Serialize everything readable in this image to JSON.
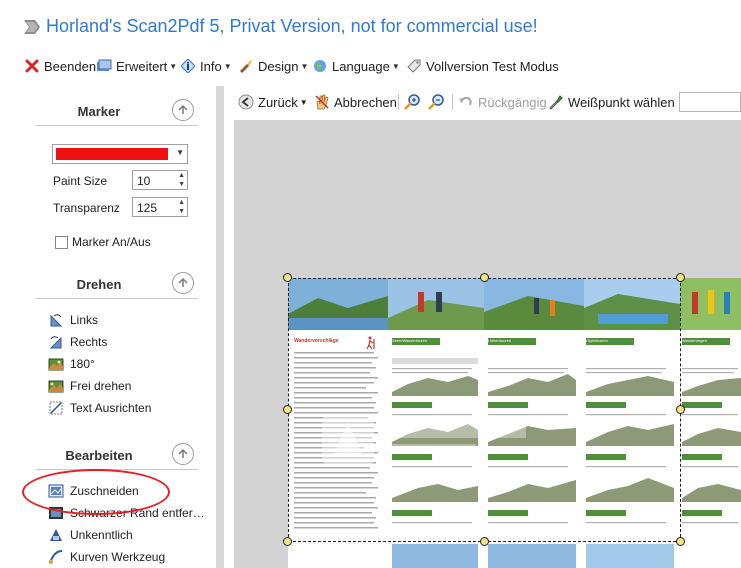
{
  "window": {
    "title": "Horland's Scan2Pdf 5, Privat Version, not for commercial use!"
  },
  "menu": {
    "items": [
      {
        "label": "Beenden",
        "icon": "close-x-icon",
        "dropdown": false
      },
      {
        "label": "Erweitert",
        "icon": "extended-icon",
        "dropdown": true
      },
      {
        "label": "Info",
        "icon": "info-icon",
        "dropdown": true
      },
      {
        "label": "Design",
        "icon": "design-icon",
        "dropdown": true
      },
      {
        "label": "Language",
        "icon": "language-icon",
        "dropdown": true
      },
      {
        "label": "Vollversion Test Modus",
        "icon": "tag-icon",
        "dropdown": false
      }
    ]
  },
  "sidebar": {
    "marker": {
      "title": "Marker",
      "color": "#ee1111",
      "paint_size_label": "Paint Size",
      "paint_size_value": "10",
      "transparenz_label": "Transparenz",
      "transparenz_value": "125",
      "marker_toggle_label": "Marker An/Aus",
      "marker_toggle_checked": false
    },
    "drehen": {
      "title": "Drehen",
      "items": [
        "Links",
        "Rechts",
        "180°",
        "Frei drehen",
        "Text Ausrichten"
      ]
    },
    "bearbeiten": {
      "title": "Bearbeiten",
      "items": [
        "Zuschneiden",
        "Schwarzer Rand entfer…",
        "Unkenntlich",
        "Kurven Werkzeug"
      ],
      "highlighted": "Zuschneiden",
      "highlight_color": "#e51f1f"
    }
  },
  "toolbar": {
    "back_label": "Zurück",
    "cancel_label": "Abbrechen",
    "undo_label": "Rückgängig",
    "whitepoint_label": "Weißpunkt wählen"
  },
  "document": {
    "heading_left": "Wandervorschläge",
    "col_heads": [
      "Seen/Wassertouren",
      "Hüttentouren",
      "Gipfeltouren",
      "Wanderungen"
    ]
  },
  "colors": {
    "title_blue": "#2e7bd6",
    "canvas_gray": "#d3d3d3",
    "handle_yellow": "#f3e48a"
  }
}
